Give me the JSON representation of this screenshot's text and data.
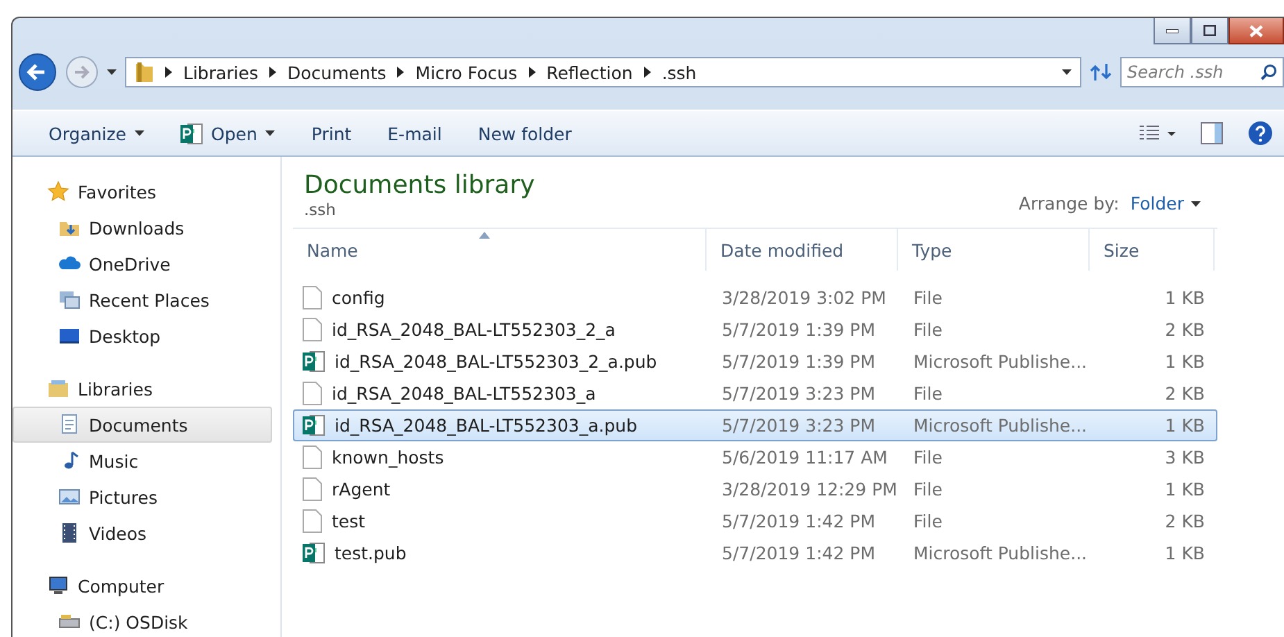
{
  "address_bar": {
    "path": [
      "Libraries",
      "Documents",
      "Micro Focus",
      "Reflection",
      ".ssh"
    ],
    "search_placeholder": "Search .ssh"
  },
  "toolbar": {
    "items": [
      {
        "label": "Organize",
        "kind": "menu"
      },
      {
        "label": "Open",
        "kind": "open"
      },
      {
        "label": "Print",
        "kind": "plain"
      },
      {
        "label": "E-mail",
        "kind": "plain"
      },
      {
        "label": "New folder",
        "kind": "plain"
      }
    ]
  },
  "sidebar": {
    "groups": [
      {
        "label": "Favorites",
        "kind": "star",
        "items": [
          {
            "label": "Downloads",
            "kind": "downloads",
            "selected": false
          },
          {
            "label": "OneDrive",
            "kind": "cloud",
            "selected": false
          },
          {
            "label": "Recent Places",
            "kind": "recent",
            "selected": false
          },
          {
            "label": "Desktop",
            "kind": "desktop",
            "selected": false
          }
        ]
      },
      {
        "label": "Libraries",
        "kind": "library",
        "items": [
          {
            "label": "Documents",
            "kind": "documents",
            "selected": true
          },
          {
            "label": "Music",
            "kind": "music",
            "selected": false
          },
          {
            "label": "Pictures",
            "kind": "pictures",
            "selected": false
          },
          {
            "label": "Videos",
            "kind": "videos",
            "selected": false
          }
        ]
      },
      {
        "label": "Computer",
        "kind": "computer",
        "items": [
          {
            "label": "(C:) OSDisk",
            "kind": "drive",
            "selected": false
          }
        ]
      }
    ]
  },
  "library": {
    "title": "Documents library",
    "subtitle": ".ssh",
    "arrange_label": "Arrange by:",
    "arrange_value": "Folder"
  },
  "table": {
    "columns": [
      {
        "label": "Name",
        "sorted": true
      },
      {
        "label": "Date modified",
        "sorted": false
      },
      {
        "label": "Type",
        "sorted": false
      },
      {
        "label": "Size",
        "sorted": false
      }
    ],
    "rows": [
      {
        "name": "config",
        "date": "3/28/2019 3:02 PM",
        "type": "File",
        "size": "1 KB",
        "kind": "file",
        "selected": false
      },
      {
        "name": "id_RSA_2048_BAL-LT552303_2_a",
        "date": "5/7/2019 1:39 PM",
        "type": "File",
        "size": "2 KB",
        "kind": "file",
        "selected": false
      },
      {
        "name": "id_RSA_2048_BAL-LT552303_2_a.pub",
        "date": "5/7/2019 1:39 PM",
        "type": "Microsoft Publishe...",
        "size": "1 KB",
        "kind": "publisher",
        "selected": false
      },
      {
        "name": "id_RSA_2048_BAL-LT552303_a",
        "date": "5/7/2019 3:23 PM",
        "type": "File",
        "size": "2 KB",
        "kind": "file",
        "selected": false
      },
      {
        "name": "id_RSA_2048_BAL-LT552303_a.pub",
        "date": "5/7/2019 3:23 PM",
        "type": "Microsoft Publishe...",
        "size": "1 KB",
        "kind": "publisher",
        "selected": true
      },
      {
        "name": "known_hosts",
        "date": "5/6/2019 11:17 AM",
        "type": "File",
        "size": "3 KB",
        "kind": "file",
        "selected": false
      },
      {
        "name": "rAgent",
        "date": "3/28/2019 12:29 PM",
        "type": "File",
        "size": "1 KB",
        "kind": "file",
        "selected": false
      },
      {
        "name": "test",
        "date": "5/7/2019 1:42 PM",
        "type": "File",
        "size": "2 KB",
        "kind": "file",
        "selected": false
      },
      {
        "name": "test.pub",
        "date": "5/7/2019 1:42 PM",
        "type": "Microsoft Publishe...",
        "size": "1 KB",
        "kind": "publisher",
        "selected": false
      }
    ]
  }
}
